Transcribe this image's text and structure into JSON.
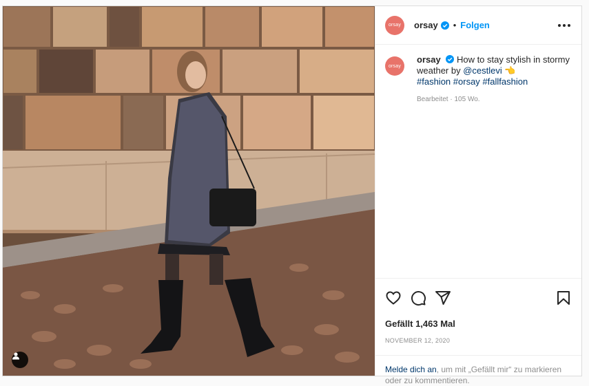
{
  "post": {
    "photo_alt": "",
    "author": {
      "avatar_text": "orsay",
      "username": "orsay",
      "follow_label": "Folgen",
      "separator": "•"
    },
    "caption": {
      "username": "orsay",
      "text": "How to stay stylish in stormy weather by",
      "mention": "@cestlevi",
      "emoji": "👈",
      "hashtags": [
        "#fashion",
        "#orsay",
        "#fallfashion"
      ],
      "edited_label": "Bearbeitet",
      "separator": "·",
      "age": "105 Wo."
    },
    "likes_label": "Gefällt 1,463 Mal",
    "date": "NOVEMBER 12, 2020",
    "login_prompt": {
      "link": "Melde dich an",
      "rest": ", um mit „Gefällt mir“ zu markieren oder zu kommentieren."
    }
  },
  "colors": {
    "accent": "#0095f6",
    "avatar_bg": "#e8736a",
    "link": "#00376b"
  },
  "icons": [
    "verified-icon",
    "more-options-icon",
    "heart-icon",
    "comment-icon",
    "share-icon",
    "bookmark-icon",
    "user-tag-icon"
  ]
}
